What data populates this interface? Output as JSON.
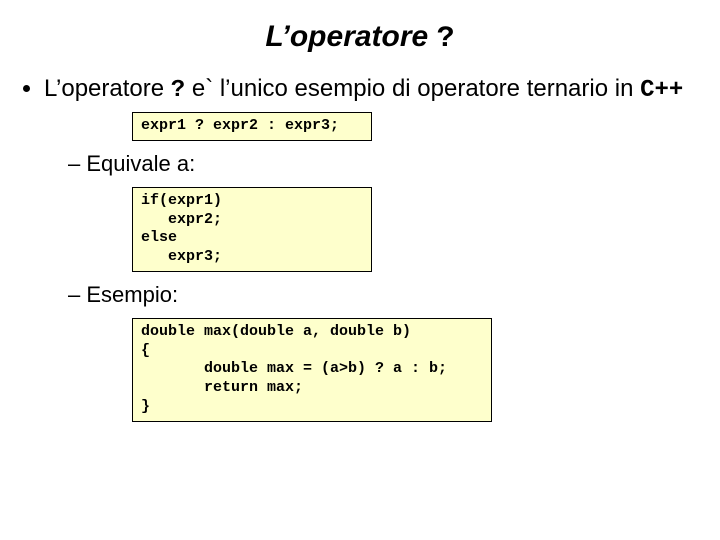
{
  "title": {
    "pre": "L’operatore ",
    "op": "?"
  },
  "bullet1": {
    "p1": "L’operatore ",
    "op": "?",
    "p2": " e` l’unico esempio di operatore ternario in ",
    "cpp": "C++"
  },
  "code1": "expr1 ? expr2 : expr3;",
  "sub1": "Equivale a:",
  "code2": "if(expr1)\n   expr2;\nelse\n   expr3;",
  "sub2": "Esempio:",
  "code3": "double max(double a, double b)\n{\n       double max = (a>b) ? a : b;\n       return max;\n}"
}
